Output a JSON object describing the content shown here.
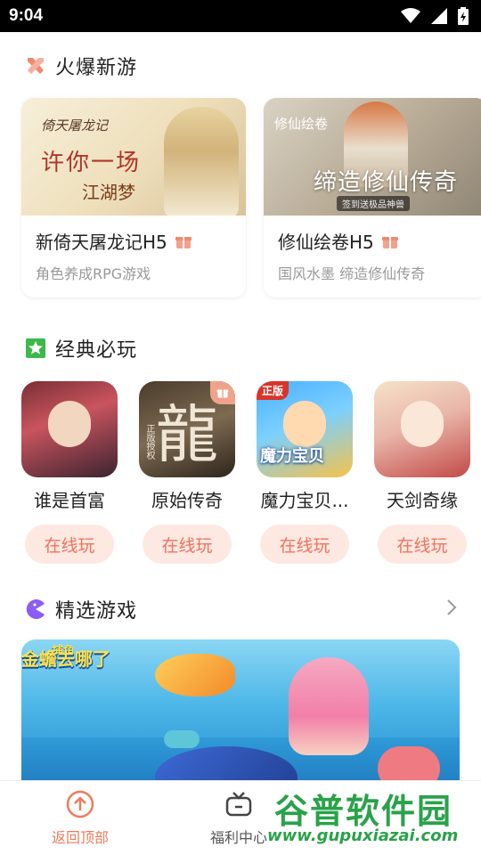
{
  "status_bar": {
    "time": "9:04"
  },
  "sections": {
    "hot": {
      "title": "火爆新游"
    },
    "classic": {
      "title": "经典必玩"
    },
    "featured": {
      "title": "精选游戏"
    }
  },
  "hot_games": [
    {
      "name": "新倚天屠龙记H5",
      "desc": "角色养成RPG游戏",
      "banner_logo": "倚天屠龙记",
      "banner_line1": "许你一场",
      "banner_line2": "江湖梦"
    },
    {
      "name": "修仙绘卷H5",
      "desc": "国风水墨 缔造修仙传奇",
      "banner_logo": "修仙绘卷",
      "banner_line1": "缔造修仙传奇",
      "banner_tag": "签到送极品神兽"
    }
  ],
  "classic_games": [
    {
      "name": "谁是首富",
      "play_label": "在线玩"
    },
    {
      "name": "原始传奇",
      "play_label": "在线玩",
      "icon_glyph": "龍",
      "icon_sub": "正版授权"
    },
    {
      "name": "魔力宝贝...",
      "play_label": "在线玩",
      "badge": "正版",
      "icon_title": "魔力宝贝"
    },
    {
      "name": "天剑奇缘",
      "play_label": "在线玩"
    }
  ],
  "featured_banner": {
    "logo_small": "捕鱼",
    "logo_main": "金蟾去哪了"
  },
  "bottom_nav": [
    {
      "label": "返回顶部",
      "active": true
    },
    {
      "label": "福利中心",
      "active": false
    }
  ],
  "watermark": {
    "cn": "谷普软件园",
    "url": "www.gupuxiazai.com"
  },
  "colors": {
    "accent": "#ef7b5d",
    "play_bg": "#fde9e1",
    "hot_icon": "#f08a6e",
    "classic_icon": "#3cb84a",
    "featured_icon": "#8b5cf6"
  }
}
